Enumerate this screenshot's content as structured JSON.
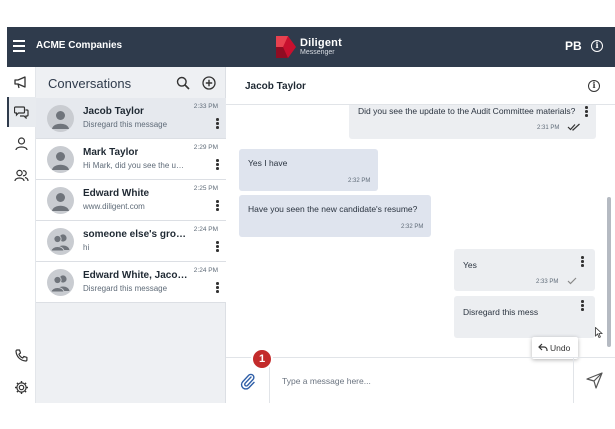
{
  "topbar": {
    "org_name": "ACME Companies",
    "logo_name": "Diligent",
    "logo_sub": "Messenger",
    "initials": "PB",
    "info_glyph": "i"
  },
  "rail": {
    "items": [
      {
        "icon": "megaphone-icon"
      },
      {
        "icon": "chat-bubbles-icon",
        "active": true
      },
      {
        "icon": "person-icon"
      },
      {
        "icon": "people-icon"
      },
      {
        "icon": "phone-icon"
      },
      {
        "icon": "gear-icon"
      }
    ]
  },
  "conversations": {
    "title": "Conversations",
    "items": [
      {
        "name": "Jacob Taylor",
        "preview": "Disregard this message",
        "time": "2:33 PM",
        "selected": true,
        "avatar": "single"
      },
      {
        "name": "Mark Taylor",
        "preview": "Hi Mark, did you see the updated",
        "time": "2:29 PM",
        "avatar": "single"
      },
      {
        "name": "Edward White",
        "preview": "www.diligent.com",
        "time": "2:25 PM",
        "avatar": "single"
      },
      {
        "name": "someone else's group",
        "preview": "hi",
        "time": "2:24 PM",
        "avatar": "group"
      },
      {
        "name": "Edward White, Jacob Taylor",
        "preview": "Disregard this message",
        "time": "2:24 PM",
        "avatar": "group"
      }
    ]
  },
  "chat": {
    "title": "Jacob Taylor",
    "info_glyph": "i",
    "messages": [
      {
        "direction": "out",
        "text": "Did you see the update to the Audit Committee materials?",
        "time": "2:31 PM",
        "status": "read"
      },
      {
        "direction": "in",
        "text": "Yes I have",
        "time": "2:32 PM"
      },
      {
        "direction": "in",
        "text": "Have you seen the new candidate's resume?",
        "time": "2:32 PM"
      },
      {
        "direction": "out",
        "text": "Yes",
        "time": "2:33 PM",
        "status": "sent"
      },
      {
        "direction": "out",
        "text": "Disregard this mess",
        "time": ""
      }
    ],
    "undo_label": "Undo",
    "composer_placeholder": "Type a message here...",
    "step_badge": "1"
  },
  "colors": {
    "topbar": "#2f3b4c",
    "accent": "#c32b2b",
    "incoming_bubble": "#dfe4ee",
    "outgoing_bubble": "#eceef1"
  }
}
